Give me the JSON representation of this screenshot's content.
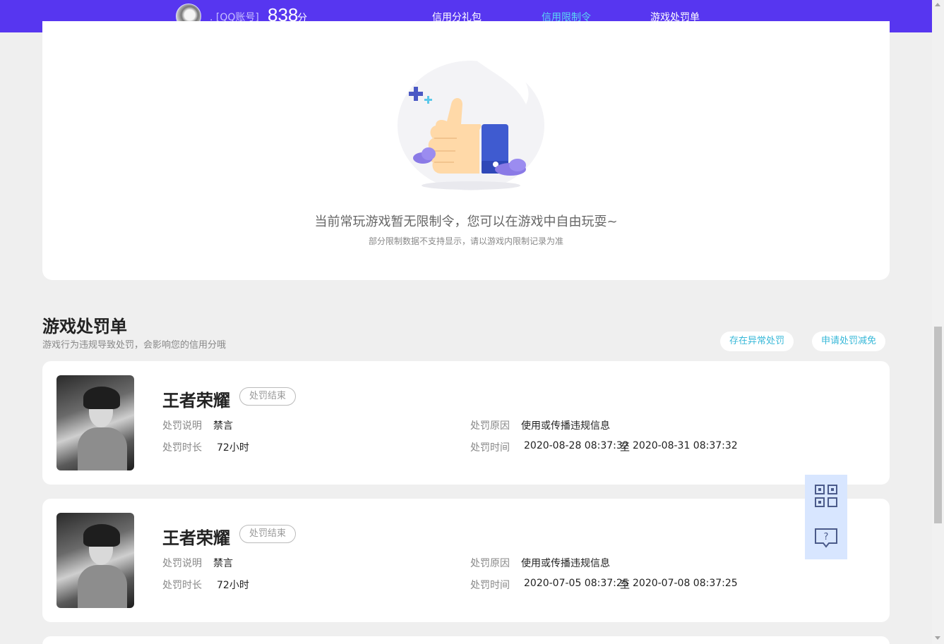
{
  "header": {
    "account_label": ". [QQ账号]",
    "score": "838",
    "score_unit": "分",
    "nav": [
      {
        "label": "信用分礼包",
        "active": false
      },
      {
        "label": "信用限制令",
        "active": true
      },
      {
        "label": "游戏处罚单",
        "active": false
      }
    ]
  },
  "restriction": {
    "message": "当前常玩游戏暂无限制令，您可以在游戏中自由玩耍~",
    "sub_message": "部分限制数据不支持显示，请以游戏内限制记录为准"
  },
  "penalty_section": {
    "title": "游戏处罚单",
    "subtitle": "游戏行为违规导致处罚，会影响您的信用分哦",
    "buttons": {
      "report_abnormal": "存在异常处罚",
      "apply_reduction": "申请处罚减免"
    },
    "labels": {
      "description": "处罚说明",
      "reason": "处罚原因",
      "duration": "处罚时长",
      "time": "处罚时间",
      "time_sep": "至"
    },
    "records": [
      {
        "game": "王者荣耀",
        "status": "处罚结束",
        "description": "禁言",
        "reason": "使用或传播违规信息",
        "duration": "72小时",
        "start": "2020-08-28 08:37:32",
        "end": "2020-08-31 08:37:32"
      },
      {
        "game": "王者荣耀",
        "status": "处罚结束",
        "description": "禁言",
        "reason": "使用或传播违规信息",
        "duration": "72小时",
        "start": "2020-07-05 08:37:25",
        "end": "2020-07-08 08:37:25"
      }
    ]
  },
  "floating": {
    "qrcode_icon": "qrcode-icon",
    "help_icon": "help-chat-icon"
  },
  "colors": {
    "topbar": "#5736f0",
    "accent": "#5bd6f5",
    "link": "#38b8d8"
  }
}
